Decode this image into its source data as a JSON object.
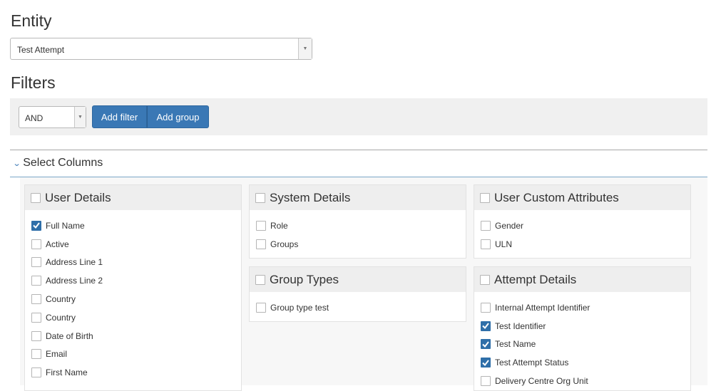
{
  "entity": {
    "heading": "Entity",
    "selected": "Test Attempt"
  },
  "filters": {
    "heading": "Filters",
    "operator": "AND",
    "add_filter_label": "Add filter",
    "add_group_label": "Add group"
  },
  "select_columns": {
    "label": "Select Columns"
  },
  "panels": {
    "user_details": {
      "title": "User Details",
      "checked": false,
      "items": [
        {
          "label": "Full Name",
          "checked": true
        },
        {
          "label": "Active",
          "checked": false
        },
        {
          "label": "Address Line 1",
          "checked": false
        },
        {
          "label": "Address Line 2",
          "checked": false
        },
        {
          "label": "Country",
          "checked": false
        },
        {
          "label": "Country",
          "checked": false
        },
        {
          "label": "Date of Birth",
          "checked": false
        },
        {
          "label": "Email",
          "checked": false
        },
        {
          "label": "First Name",
          "checked": false
        }
      ]
    },
    "system_details": {
      "title": "System Details",
      "checked": false,
      "items": [
        {
          "label": "Role",
          "checked": false
        },
        {
          "label": "Groups",
          "checked": false
        }
      ]
    },
    "group_types": {
      "title": "Group Types",
      "checked": false,
      "items": [
        {
          "label": "Group type test",
          "checked": false
        }
      ]
    },
    "user_custom_attributes": {
      "title": "User Custom Attributes",
      "checked": false,
      "items": [
        {
          "label": "Gender",
          "checked": false
        },
        {
          "label": "ULN",
          "checked": false
        }
      ]
    },
    "attempt_details": {
      "title": "Attempt Details",
      "checked": false,
      "items": [
        {
          "label": "Internal Attempt Identifier",
          "checked": false
        },
        {
          "label": "Test Identifier",
          "checked": true
        },
        {
          "label": "Test Name",
          "checked": true
        },
        {
          "label": "Test Attempt Status",
          "checked": true
        },
        {
          "label": "Delivery Centre Org Unit",
          "checked": false
        }
      ]
    }
  },
  "colors": {
    "accent": "#3a78b5",
    "checkbox_checked": "#2f6fa9"
  }
}
